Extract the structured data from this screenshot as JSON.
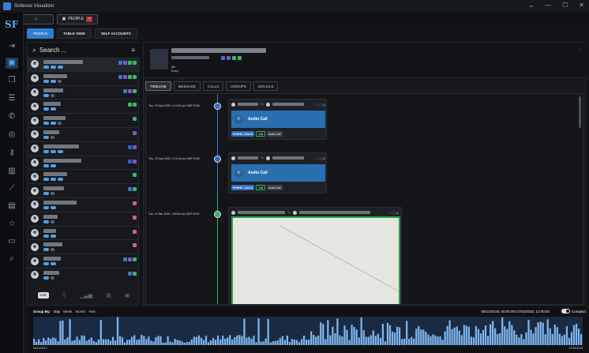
{
  "app": {
    "title": "Sixfence Visualizer"
  },
  "window_controls": [
    "⌄",
    "—",
    "☐",
    "✕"
  ],
  "top_nav": {
    "home_icon": "home-icon",
    "people_label": "PEOPLE"
  },
  "sidebar": {
    "logo": "SF",
    "icons": [
      "login-icon",
      "people-icon",
      "files-icon",
      "message-icon",
      "phone-icon",
      "globe-icon",
      "key-icon",
      "map-icon",
      "chart-icon",
      "doc-icon",
      "star-icon",
      "window-icon",
      "search-icon"
    ]
  },
  "tabs": [
    {
      "label": "PEOPLE",
      "active": true
    },
    {
      "label": "TABLE VIEW",
      "active": false
    },
    {
      "label": "SELF ACCOUNTS",
      "active": false
    }
  ],
  "people_panel": {
    "search_placeholder": "Search ...",
    "count": "9.5k"
  },
  "detail": {
    "status": "Busy",
    "meta_label": "life",
    "tabs": [
      "TIMELINE",
      "MESSAGE",
      "CALLS",
      "GROUPS",
      "SOCIALS"
    ],
    "events": [
      {
        "date": "Thu, 20 Mar 2025, 1:41:52 pm GMT+5:30",
        "to_label": "To",
        "title": "Audio Call",
        "tags": [
          "PHONE_CALLS",
          "Call",
          "Audio Call"
        ]
      },
      {
        "date": "Thu, 20 Mar 2025, 1:41:44 pm GMT+5:30",
        "to_label": "To",
        "title": "Audio Call",
        "tags": [
          "PHONE_CALLS",
          "Call",
          "Audio Call"
        ]
      },
      {
        "date": "Tue, 11 Mar 2025, 1:08:54 am GMT+5:30",
        "to_label": "To",
        "title": ""
      }
    ]
  },
  "bottom": {
    "group_by_label": "Group By:",
    "options": [
      "Day",
      "Week",
      "Month",
      "Year"
    ],
    "active_option": "Day",
    "range": "08/12/2019, 00:00:00-27/03/2025, 12:00:00",
    "compact_label": "Compact",
    "start_date": "08/12/2019",
    "end_date": "27/03/2025"
  },
  "colors": {
    "accent": "#2f7fd0",
    "call_box": "#2a6fb0",
    "green": "#2bb664",
    "hist_bar": "#7fb7ee"
  }
}
